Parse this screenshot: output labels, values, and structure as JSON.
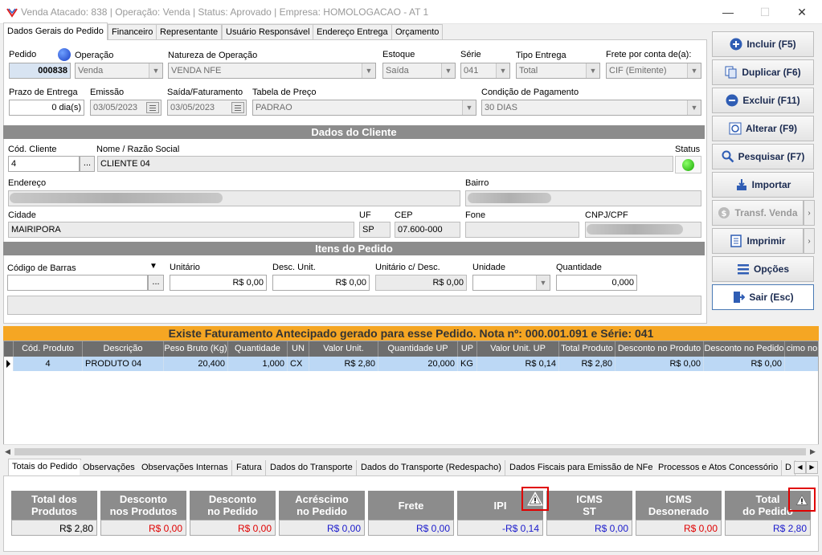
{
  "window": {
    "title": "Venda Atacado: 838 | Operação: Venda | Status: Aprovado | Empresa: HOMOLOGACAO - AT 1"
  },
  "tabs": [
    "Dados Gerais do Pedido",
    "Financeiro",
    "Representante",
    "Usuário Responsável",
    "Endereço Entrega",
    "Orçamento"
  ],
  "pedido": {
    "pedido_label": "Pedido",
    "pedido_value": "000838",
    "operacao_label": "Operação",
    "operacao_value": "Venda",
    "natureza_label": "Natureza de Operação",
    "natureza_value": "VENDA NFE",
    "estoque_label": "Estoque",
    "estoque_value": "Saída",
    "serie_label": "Série",
    "serie_value": "041",
    "tipo_entrega_label": "Tipo Entrega",
    "tipo_entrega_value": "Total",
    "frete_label": "Frete por conta de(a):",
    "frete_value": "CIF (Emitente)",
    "prazo_label": "Prazo de Entrega",
    "prazo_value": "0 dia(s)",
    "emissao_label": "Emissão",
    "emissao_value": "03/05/2023",
    "saida_label": "Saída/Faturamento",
    "saida_value": "03/05/2023",
    "tabela_label": "Tabela de Preço",
    "tabela_value": "PADRAO",
    "condicao_label": "Condição de Pagamento",
    "condicao_value": "30 DIAS"
  },
  "cliente": {
    "section_title": "Dados do Cliente",
    "cod_label": "Cód. Cliente",
    "cod_value": "4",
    "lookup": "...",
    "nome_label": "Nome / Razão Social",
    "nome_value": "CLIENTE 04",
    "status_label": "Status",
    "endereco_label": "Endereço",
    "bairro_label": "Bairro",
    "cidade_label": "Cidade",
    "cidade_value": "MAIRIPORA",
    "uf_label": "UF",
    "uf_value": "SP",
    "cep_label": "CEP",
    "cep_value": "07.600-000",
    "fone_label": "Fone",
    "fone_value": "",
    "cnpj_label": "CNPJ/CPF"
  },
  "itens": {
    "section_title": "Itens do Pedido",
    "barras_label": "Código de Barras",
    "barras_value": "",
    "lookup": "...",
    "unitario_label": "Unitário",
    "unitario_value": "R$ 0,00",
    "desc_label": "Desc. Unit.",
    "desc_value": "R$ 0,00",
    "unit_desc_label": "Unitário c/ Desc.",
    "unit_desc_value": "R$ 0,00",
    "unidade_label": "Unidade",
    "unidade_value": "",
    "quantidade_label": "Quantidade",
    "quantidade_value": "0,000"
  },
  "actions": [
    {
      "label": "Incluir (F5)",
      "icon": "plus-circle-icon"
    },
    {
      "label": "Duplicar (F6)",
      "icon": "duplicate-icon"
    },
    {
      "label": "Excluir (F11)",
      "icon": "minus-circle-icon"
    },
    {
      "label": "Alterar (F9)",
      "icon": "refresh-icon"
    },
    {
      "label": "Pesquisar (F7)",
      "icon": "search-icon"
    },
    {
      "label": "Importar",
      "icon": "import-icon"
    },
    {
      "label": "Transf. Venda",
      "icon": "transfer-icon"
    },
    {
      "label": "Imprimir",
      "icon": "document-icon"
    },
    {
      "label": "Opções",
      "icon": "menu-icon"
    },
    {
      "label": "Sair (Esc)",
      "icon": "exit-icon"
    }
  ],
  "banner": "Existe Faturamento Antecipado gerado para esse Pedido. Nota nº: 000.001.091 e Série: 041",
  "grid": {
    "columns": [
      "Cód. Produto",
      "Descrição",
      "Peso Bruto (Kg)",
      "Quantidade",
      "UN",
      "Valor Unit.",
      "Quantidade UP",
      "UP",
      "Valor Unit. UP",
      "Total Produto",
      "Desconto no Produto",
      "Desconto no Pedido",
      "cimo no"
    ],
    "rows": [
      [
        "4",
        "PRODUTO 04",
        "20,400",
        "1,000",
        "CX",
        "R$ 2,80",
        "20,000",
        "KG",
        "R$ 0,14",
        "R$ 2,80",
        "R$ 0,00",
        "R$ 0,00",
        ""
      ]
    ]
  },
  "bottom_tabs": [
    "Totais do Pedido",
    "Observações",
    "Observações Internas",
    "Fatura",
    "Dados do Transporte",
    "Dados do Transporte (Redespacho)",
    "Dados Fiscais para Emissão de NFe",
    "Processos e Atos Concessório",
    "D"
  ],
  "totals": [
    {
      "label1": "Total dos",
      "label2": "Produtos",
      "value": "R$ 2,80",
      "color": "black"
    },
    {
      "label1": "Desconto",
      "label2": "nos Produtos",
      "value": "R$ 0,00",
      "color": "red"
    },
    {
      "label1": "Desconto",
      "label2": "no Pedido",
      "value": "R$ 0,00",
      "color": "red"
    },
    {
      "label1": "Acréscimo",
      "label2": "no Pedido",
      "value": "R$ 0,00",
      "color": "blue"
    },
    {
      "label1": "Frete",
      "label2": "",
      "value": "R$ 0,00",
      "color": "blue"
    },
    {
      "label1": "IPI",
      "label2": "",
      "value": "-R$ 0,14",
      "color": "blue"
    },
    {
      "label1": "ICMS",
      "label2": "ST",
      "value": "R$ 0,00",
      "color": "blue"
    },
    {
      "label1": "ICMS",
      "label2": "Desonerado",
      "value": "R$ 0,00",
      "color": "red"
    },
    {
      "label1": "Total",
      "label2": "do Pedido",
      "value": "R$ 2,80",
      "color": "blue"
    }
  ],
  "colors": {
    "banner": "#f5a623",
    "section": "#8c8c8c",
    "row_selected": "#bcd8f5",
    "warning": "#e00000"
  }
}
